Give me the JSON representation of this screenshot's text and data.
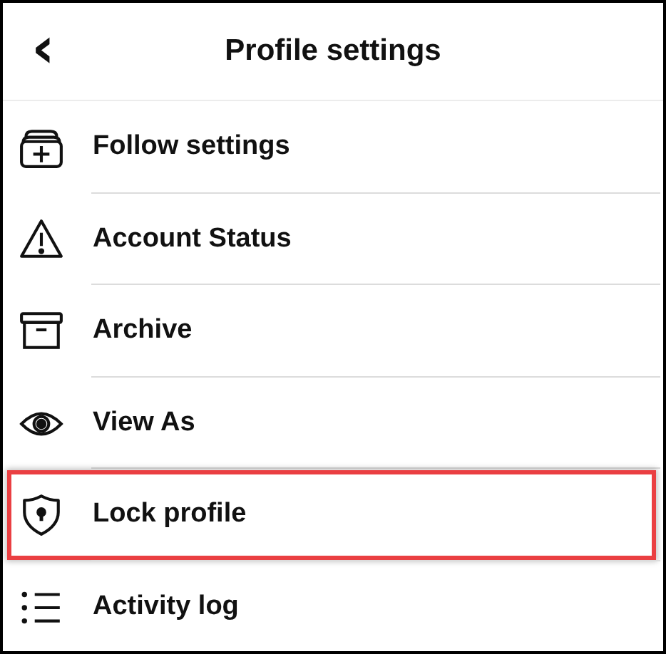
{
  "header": {
    "back": "‹",
    "title": "Profile settings"
  },
  "items": [
    {
      "label": "Follow settings",
      "highlighted": false
    },
    {
      "label": "Account Status",
      "highlighted": false
    },
    {
      "label": "Archive",
      "highlighted": false
    },
    {
      "label": "View As",
      "highlighted": false
    },
    {
      "label": "Lock profile",
      "highlighted": true
    },
    {
      "label": "Activity log",
      "highlighted": false
    }
  ]
}
